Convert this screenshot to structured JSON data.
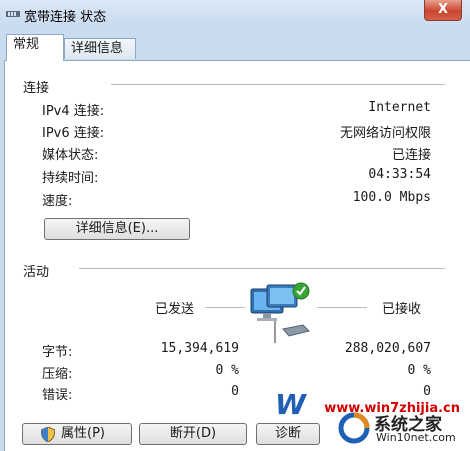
{
  "window": {
    "title": "宽带连接 状态",
    "close_label": "X"
  },
  "tabs": [
    {
      "label": "常规"
    },
    {
      "label": "详细信息"
    }
  ],
  "connection": {
    "section_label": "连接",
    "rows": [
      {
        "label": "IPv4 连接:",
        "value": "Internet"
      },
      {
        "label": "IPv6 连接:",
        "value": "无网络访问权限"
      },
      {
        "label": "媒体状态:",
        "value": "已连接"
      },
      {
        "label": "持续时间:",
        "value": "04:33:54"
      },
      {
        "label": "速度:",
        "value": "100.0 Mbps"
      }
    ],
    "details_button": "详细信息(E)..."
  },
  "activity": {
    "section_label": "活动",
    "sent_label": "已发送",
    "received_label": "已接收",
    "rows": [
      {
        "label": "字节:",
        "sent": "15,394,619",
        "received": "288,020,607"
      },
      {
        "label": "压缩:",
        "sent": "0 %",
        "received": "0 %"
      },
      {
        "label": "错误:",
        "sent": "0",
        "received": "0"
      }
    ]
  },
  "buttons": {
    "properties": "属性(P)",
    "disconnect": "断开(D)",
    "diagnose": "诊断"
  },
  "watermark": {
    "url": "www.win7zhijia.cn",
    "logo_text": "系统之家",
    "logo_url": "Win10net.com"
  },
  "colors": {
    "titlebar": "#c7d9ee",
    "watermark_red": "#d40000",
    "logo_blue": "#1f5fb5"
  },
  "icons": {
    "title": "network-adapter-icon",
    "activity": "network-computers-icon",
    "properties": "shield-icon"
  }
}
